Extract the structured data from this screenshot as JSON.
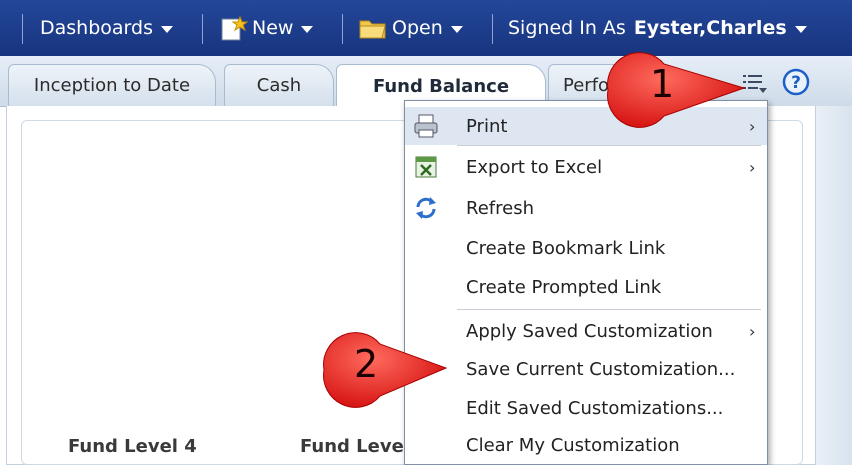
{
  "header": {
    "dashboards": "Dashboards",
    "new": "New",
    "open": "Open",
    "signed_in_as": "Signed In As",
    "user_name": "Eyster,Charles"
  },
  "tabs": [
    {
      "label": "Inception to Date"
    },
    {
      "label": "Cash"
    },
    {
      "label": "Fund Balance"
    },
    {
      "label": "Perfo"
    }
  ],
  "page_menu": {
    "items": [
      {
        "label": "Print",
        "submenu": "›",
        "icon": "printer-icon"
      },
      {
        "label": "Export to Excel",
        "submenu": "›",
        "icon": "excel-icon"
      },
      {
        "label": "Refresh",
        "icon": "refresh-icon"
      },
      {
        "label": "Create Bookmark Link"
      },
      {
        "label": "Create Prompted Link"
      },
      {
        "label": "Apply Saved Customization",
        "submenu": "›"
      },
      {
        "label": "Save Current Customization..."
      },
      {
        "label": "Edit Saved Customizations..."
      },
      {
        "label": "Clear My Customization"
      }
    ]
  },
  "content": {
    "fund_level_4": "Fund Level 4",
    "fund_level_partial": "Fund Leve"
  },
  "callouts": {
    "one": "1",
    "two": "2"
  },
  "colors": {
    "header_bg": "#1a3a87",
    "callout_red": "#e21b1b",
    "menu_highlight": "#dde6f1"
  }
}
